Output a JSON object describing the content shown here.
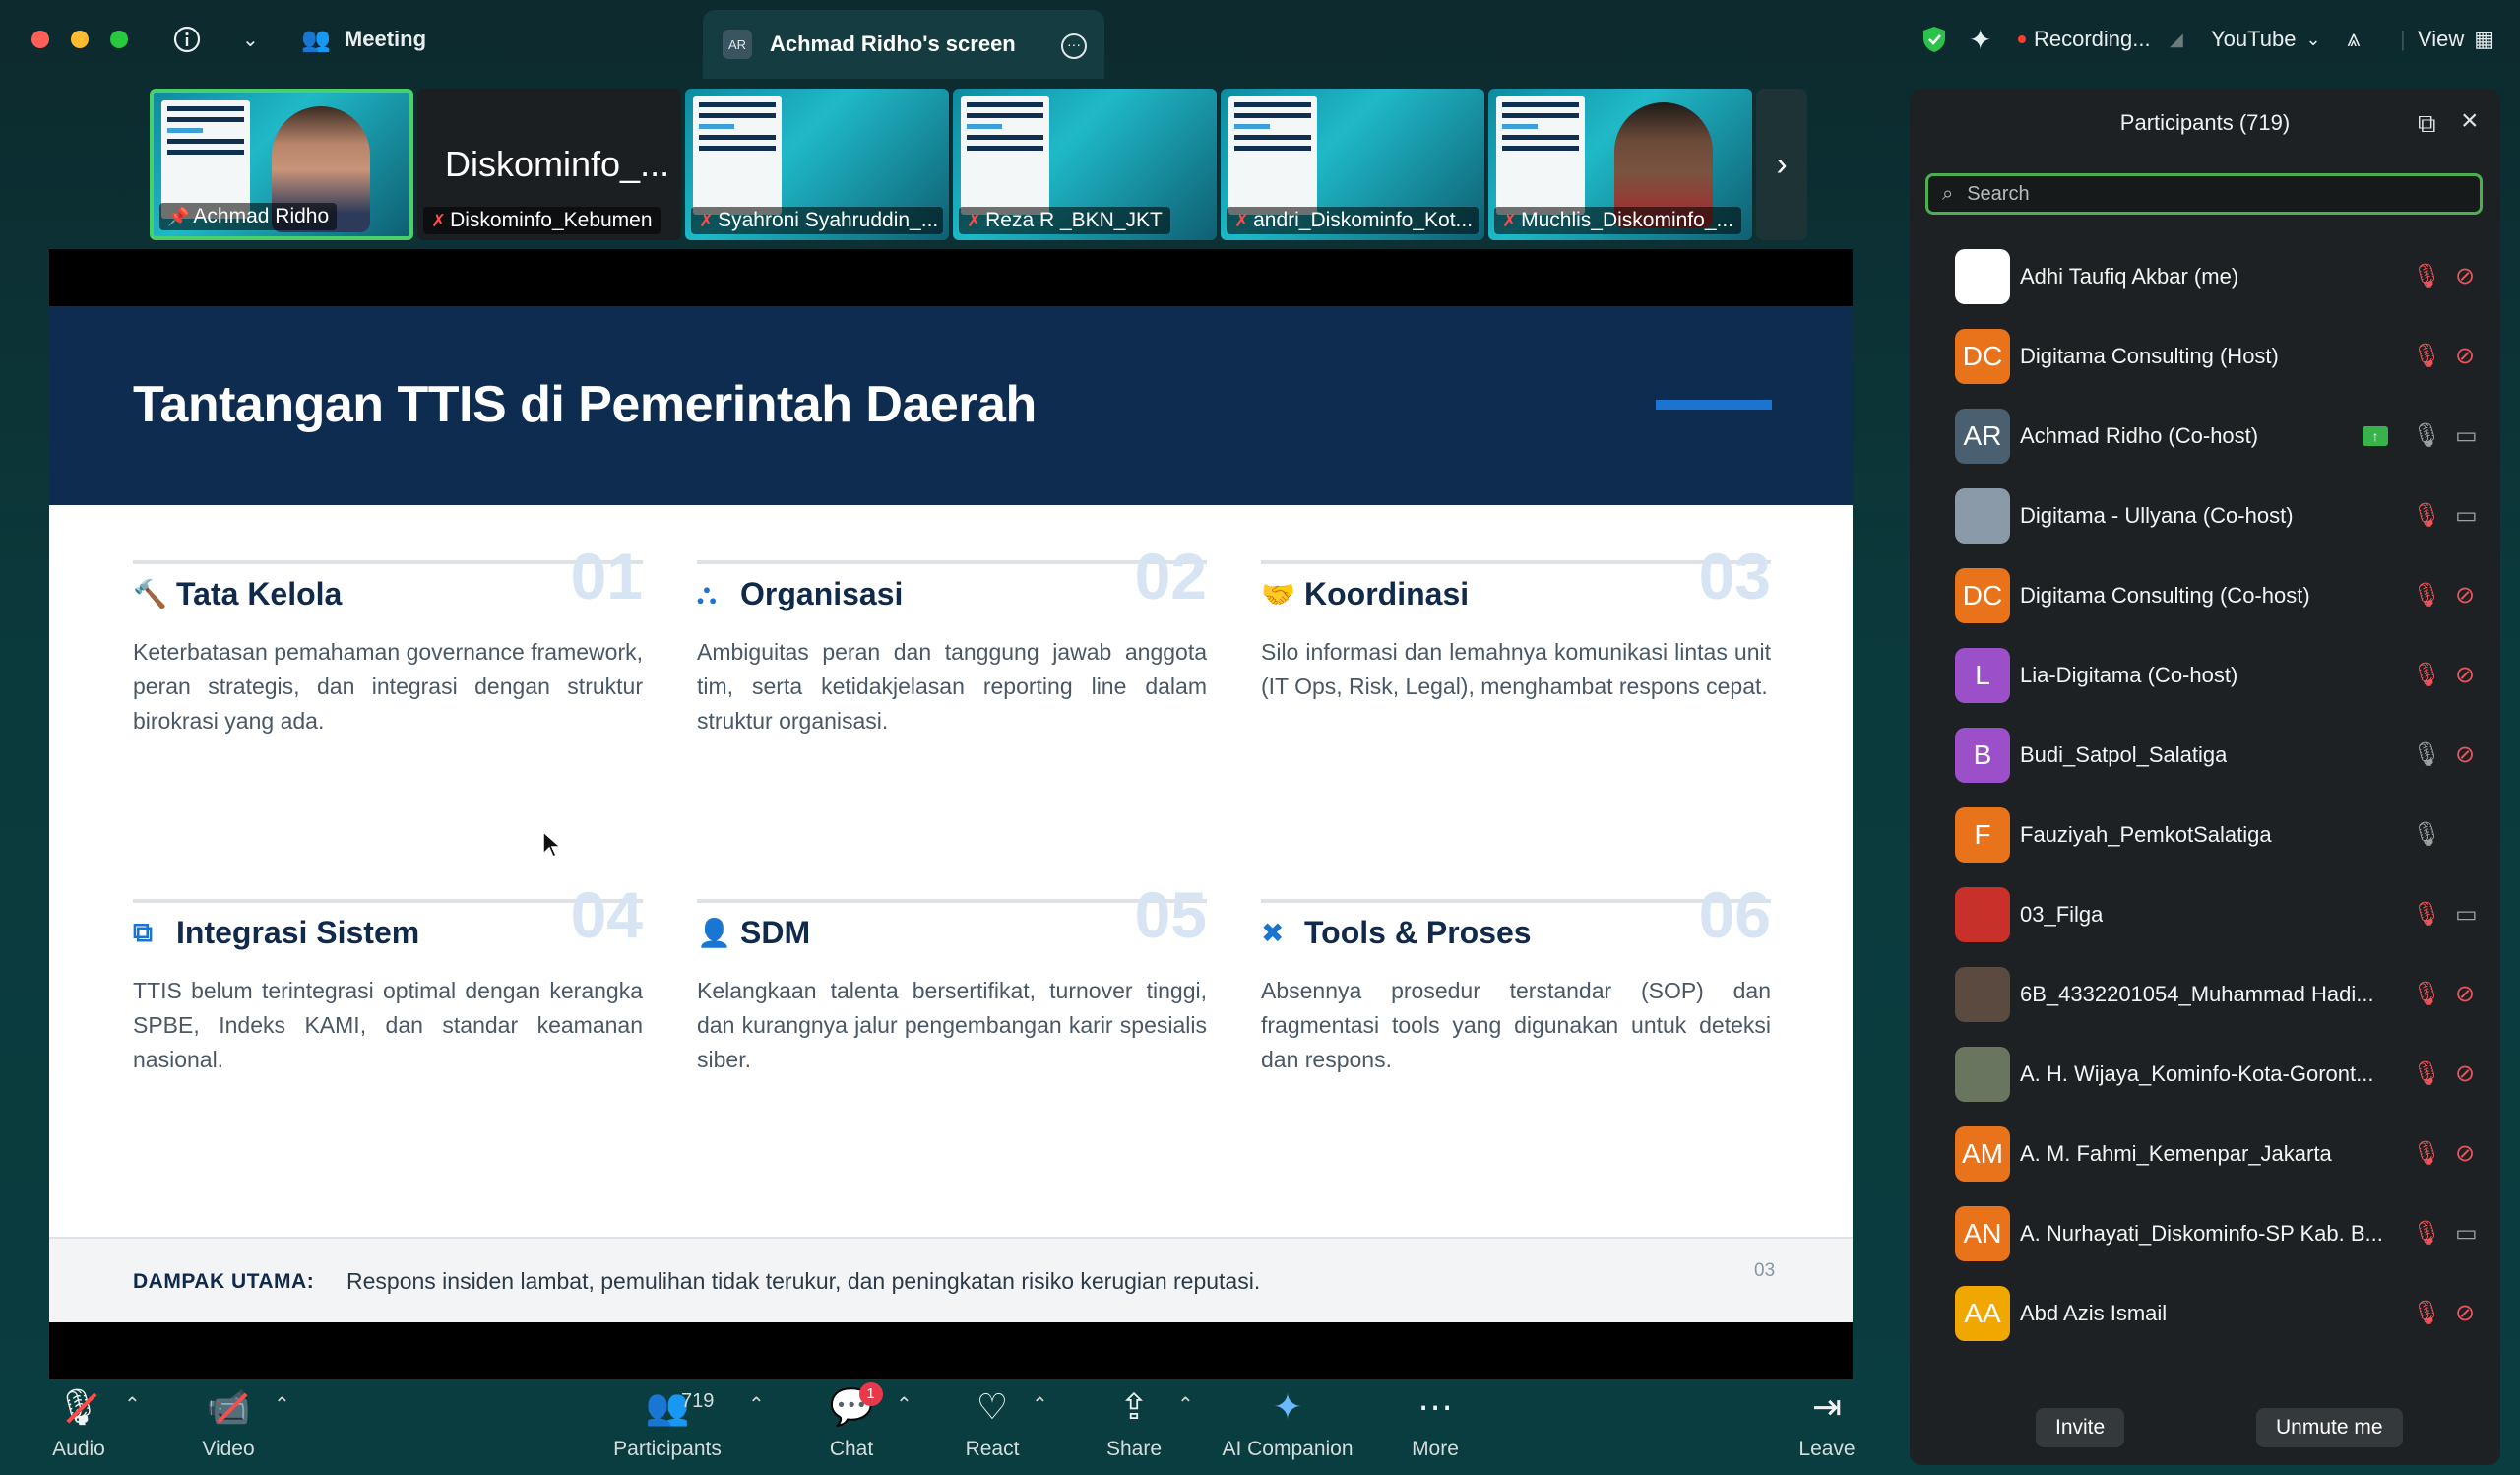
{
  "topbar": {
    "meeting_label": "Meeting",
    "share_tab": {
      "initials": "AR",
      "label": "Achmad Ridho's screen"
    },
    "recording_label": "Recording...",
    "youtube_label": "YouTube",
    "view_label": "View"
  },
  "thumbnails": [
    {
      "name": "Achmad Ridho",
      "active": true
    },
    {
      "name": "Diskominfo_Kebumen",
      "big_name": "Diskominfo_..."
    },
    {
      "name": "Syahroni Syahruddin_..."
    },
    {
      "name": "Reza R _BKN_JKT"
    },
    {
      "name": "andri_Diskominfo_Kot..."
    },
    {
      "name": "Muchlis_Diskominfo_..."
    }
  ],
  "slide": {
    "title": "Tantangan TTIS di Pemerintah Daerah",
    "cards": [
      {
        "num": "01",
        "icon": "gavel-icon",
        "title": "Tata Kelola",
        "desc": "Keterbatasan pemahaman governance framework, peran strategis, dan integrasi dengan struktur birokrasi yang ada."
      },
      {
        "num": "02",
        "icon": "org-chart-icon",
        "title": "Organisasi",
        "desc": "Ambiguitas peran dan tanggung jawab anggota tim, serta ketidakjelasan reporting line dalam struktur organisasi."
      },
      {
        "num": "03",
        "icon": "handshake-icon",
        "title": "Koordinasi",
        "desc": "Silo informasi dan lemahnya komunikasi lintas unit (IT Ops, Risk, Legal), menghambat respons cepat."
      },
      {
        "num": "04",
        "icon": "network-icon",
        "title": "Integrasi Sistem",
        "desc": "TTIS belum terintegrasi optimal dengan kerangka SPBE, Indeks KAMI, dan standar keamanan nasional."
      },
      {
        "num": "05",
        "icon": "user-tie-icon",
        "title": "SDM",
        "desc": "Kelangkaan talenta bersertifikat, turnover tinggi, dan kurangnya jalur pengembangan karir spesialis siber."
      },
      {
        "num": "06",
        "icon": "tools-icon",
        "title": "Tools & Proses",
        "desc": "Absennya prosedur terstandar (SOP) dan fragmentasi tools yang digunakan untuk deteksi dan respons."
      }
    ],
    "footer_label": "DAMPAK UTAMA:",
    "footer_text": "Respons insiden lambat, pemulihan tidak terukur, dan peningkatan risiko kerugian reputasi.",
    "page_number": "03"
  },
  "panel": {
    "title": "Participants (719)",
    "search_placeholder": "Search",
    "participants": [
      {
        "avatar": "",
        "avatar_color": "#ffffff",
        "name": "Adhi Taufiq Akbar (me)",
        "mic": "muted",
        "cam": "off"
      },
      {
        "avatar": "DC",
        "avatar_color": "#e8731a",
        "name": "Digitama Consulting (Host)",
        "mic": "muted",
        "cam": "off"
      },
      {
        "avatar": "AR",
        "avatar_color": "#4a5f70",
        "name": "Achmad Ridho (Co-host)",
        "mic": "on",
        "cam": "on",
        "sharing": true
      },
      {
        "avatar": "",
        "avatar_color": "#8a9aa8",
        "name": "Digitama - Ullyana (Co-host)",
        "mic": "muted",
        "cam": "on"
      },
      {
        "avatar": "DC",
        "avatar_color": "#e8731a",
        "name": "Digitama Consulting (Co-host)",
        "mic": "muted",
        "cam": "off"
      },
      {
        "avatar": "L",
        "avatar_color": "#9b4fc8",
        "name": "Lia-Digitama (Co-host)",
        "mic": "muted",
        "cam": "off"
      },
      {
        "avatar": "B",
        "avatar_color": "#9b4fc8",
        "name": "Budi_Satpol_Salatiga",
        "mic": "on",
        "cam": "off"
      },
      {
        "avatar": "F",
        "avatar_color": "#e8731a",
        "name": "Fauziyah_PemkotSalatiga",
        "mic": "on",
        "cam": "none"
      },
      {
        "avatar": "",
        "avatar_color": "#c8302a",
        "name": "03_Filga",
        "mic": "muted",
        "cam": "on"
      },
      {
        "avatar": "",
        "avatar_color": "#5a4a40",
        "name": "6B_4332201054_Muhammad Hadi...",
        "mic": "muted",
        "cam": "off"
      },
      {
        "avatar": "",
        "avatar_color": "#6a7560",
        "name": "A. H. Wijaya_Kominfo-Kota-Goront...",
        "mic": "muted",
        "cam": "off"
      },
      {
        "avatar": "AM",
        "avatar_color": "#e8731a",
        "name": "A. M. Fahmi_Kemenpar_Jakarta",
        "mic": "muted",
        "cam": "off"
      },
      {
        "avatar": "AN",
        "avatar_color": "#e8731a",
        "name": "A. Nurhayati_Diskominfo-SP Kab. B...",
        "mic": "muted",
        "cam": "on"
      },
      {
        "avatar": "AA",
        "avatar_color": "#f0a800",
        "name": "Abd Azis Ismail",
        "mic": "muted",
        "cam": "off"
      }
    ],
    "invite_label": "Invite",
    "unmute_label": "Unmute me"
  },
  "toolbar": {
    "audio": "Audio",
    "video": "Video",
    "participants": "Participants",
    "participants_count": "719",
    "chat": "Chat",
    "chat_badge": "1",
    "react": "React",
    "share": "Share",
    "ai_companion": "AI Companion",
    "more": "More",
    "leave": "Leave"
  }
}
